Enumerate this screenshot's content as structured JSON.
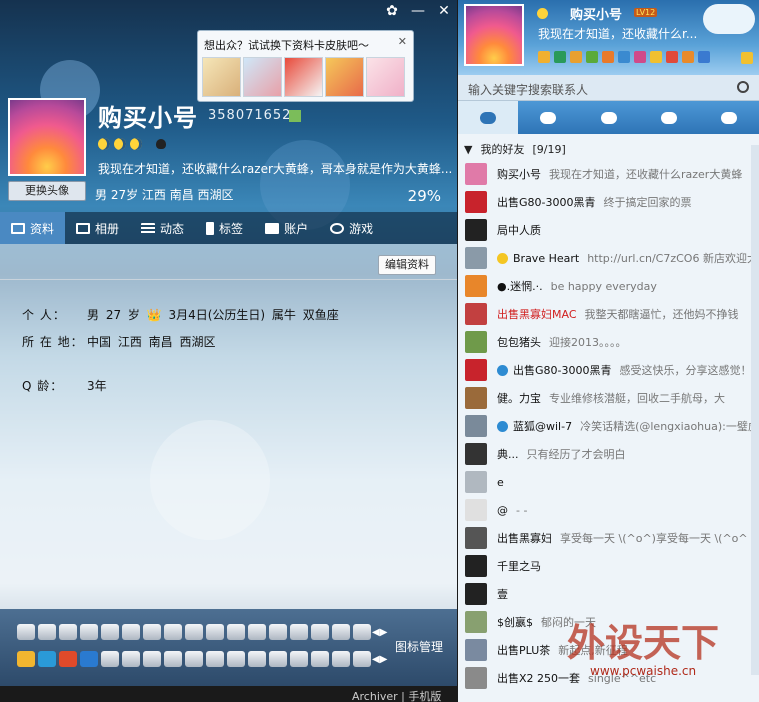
{
  "profile": {
    "popup_text": "想出众？试试换下资料卡皮肤吧～",
    "popup_close": "✕",
    "change_avatar": "更换头像",
    "nickname": "购买小号",
    "qq_number": "358071652",
    "signature": "我现在才知道，还收藏什么razer大黄蜂，哥本身就是作为大黄蜂...",
    "basic": "男   27岁    江西 南昌 西湖区",
    "completion": "29%",
    "tabs": [
      "资料",
      "相册",
      "动态",
      "标签",
      "账户",
      "游戏"
    ],
    "edit_button": "编辑资料",
    "info": [
      {
        "label": "个    人：",
        "value": "男   27 岁   👑 3月4日(公历生日)    属牛    双鱼座"
      },
      {
        "label": "所 在 地：",
        "value": "中国 江西 南昌 西湖区"
      },
      {
        "label": "Q      龄：",
        "value": "3年"
      }
    ],
    "icon_manager": "图标管理",
    "window_controls": {
      "minimize": "—",
      "close": "✕"
    }
  },
  "panel": {
    "nickname": "购买小号",
    "level": "LV12",
    "signature": "我现在才知道，还收藏什么r...",
    "search_placeholder": "输入关键字搜索联系人",
    "group_name": "我的好友",
    "group_count": "[9/19]",
    "contacts": [
      {
        "name": "购买小号",
        "status": "我现在才知道，还收藏什么razer大黄蜂",
        "red": false,
        "badge": "",
        "color": "#e07aa8"
      },
      {
        "name": "出售G80-3000黑青",
        "status": "终于搞定回家的票",
        "red": false,
        "badge": "",
        "color": "#c8232c"
      },
      {
        "name": "局中人质",
        "status": "",
        "red": false,
        "badge": "",
        "color": "#222222"
      },
      {
        "name": "Brave Heart",
        "status": "http://url.cn/C7zCO6  新店欢迎大家",
        "red": false,
        "badge": "star",
        "color": "#8a9aa8"
      },
      {
        "name": "●.迷惘.·.",
        "status": "be happy everyday",
        "red": false,
        "badge": "",
        "color": "#e8862a"
      },
      {
        "name": "出售黑寡妇MAC",
        "status": "我整天都瞎逼忙，还他妈不挣钱",
        "red": true,
        "badge": "",
        "color": "#c24040"
      },
      {
        "name": "包包猪头",
        "status": "迎接2013。。。。",
        "red": false,
        "badge": "",
        "color": "#6f9a4a"
      },
      {
        "name": "出售G80-3000黑青",
        "status": "感受这快乐，分享这感觉！",
        "red": false,
        "badge": "blue",
        "color": "#c8232c"
      },
      {
        "name": "健。力宝",
        "status": "专业维修核潜艇，回收二手航母，大",
        "red": false,
        "badge": "",
        "color": "#9a6a3a"
      },
      {
        "name": "蓝狐@wil-7",
        "status": "冷笑话精选(@lengxiaohua):一璧虎",
        "red": false,
        "badge": "blue",
        "color": "#7a8a9a"
      },
      {
        "name": "典...",
        "status": "只有经历了才会明白",
        "red": false,
        "badge": "",
        "color": "#333333"
      },
      {
        "name": "e",
        "status": "",
        "red": false,
        "badge": "",
        "color": "#b0b8c0"
      },
      {
        "name": "@",
        "status": "- -",
        "red": false,
        "badge": "",
        "color": "#e0e0e0"
      },
      {
        "name": "出售黑寡妇",
        "status": "享受每一天 \\(^o^)享受每一天 \\(^o^",
        "red": false,
        "badge": "",
        "color": "#555555"
      },
      {
        "name": "千里之马",
        "status": "",
        "red": false,
        "badge": "",
        "color": "#222222"
      },
      {
        "name": "壹",
        "status": "",
        "red": false,
        "badge": "",
        "color": "#222222"
      },
      {
        "name": "$创嬴$",
        "status": "郁闷的一天",
        "red": false,
        "badge": "",
        "color": "#88a070"
      },
      {
        "name": "出售PLU茶",
        "status": "新起点,新征程",
        "red": false,
        "badge": "",
        "color": "#7a8aa0"
      },
      {
        "name": "出售X2 250一套",
        "status": "single^^etc",
        "red": false,
        "badge": "",
        "color": "#8a8a8a"
      }
    ]
  },
  "footer": {
    "archiver": "Archiver  |  手机版"
  },
  "watermark": {
    "title": "外设天下",
    "url": "www.pcwaishe.cn"
  }
}
